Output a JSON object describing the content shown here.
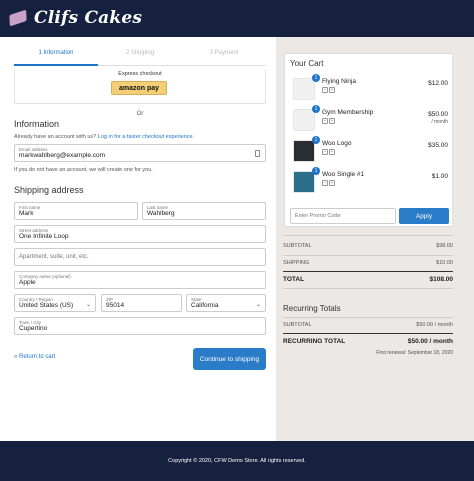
{
  "brand": {
    "name": "Clifs Cakes"
  },
  "steps": [
    "1 Information",
    "2 Shipping",
    "3 Payment"
  ],
  "express": {
    "label": "Express checkout",
    "amazon_label": "amazon pay"
  },
  "or_text": "Or",
  "information": {
    "heading": "Information",
    "login_prefix": "Already have an account with us?",
    "login_link": "Log in for a faster checkout experience.",
    "email_label": "Email address",
    "email_value": "markwahlberg@example.com",
    "note": "If you do not have an account, we will create one for you."
  },
  "shipping": {
    "heading": "Shipping address",
    "first_name_label": "First name",
    "first_name": "Mark",
    "last_name_label": "Last name",
    "last_name": "Wahlberg",
    "street_label": "Street address",
    "street": "One Infinite Loop",
    "apt_placeholder": "Apartment, suite, unit, etc.",
    "company_label": "Company name (optional)",
    "company": "Apple",
    "country_label": "Country / Region",
    "country": "United States (US)",
    "zip_label": "ZIP",
    "zip": "95014",
    "state_label": "State",
    "state": "California",
    "city_label": "Town / City",
    "city": "Cupertino"
  },
  "actions": {
    "return": "« Return to cart",
    "continue": "Continue to shipping"
  },
  "cart": {
    "title": "Your Cart",
    "items": [
      {
        "name": "Flying Ninja",
        "qty": "1",
        "price": "$12.00",
        "per": ""
      },
      {
        "name": "Gym Membership",
        "qty": "1",
        "price": "$50.00",
        "per": "/ month"
      },
      {
        "name": "Woo Logo",
        "qty": "1",
        "price": "$35.00",
        "per": ""
      },
      {
        "name": "Woo Single #1",
        "qty": "1",
        "price": "$1.00",
        "per": ""
      }
    ],
    "promo_placeholder": "Enter Promo Code",
    "apply": "Apply"
  },
  "totals": {
    "subtotal_label": "SUBTOTAL",
    "subtotal": "$98.00",
    "shipping_label": "SHIPPING",
    "shipping": "$10.00",
    "total_label": "TOTAL",
    "total": "$108.00"
  },
  "recurring": {
    "title": "Recurring Totals",
    "subtotal_label": "SUBTOTAL",
    "subtotal": "$50.00 / month",
    "total_label": "RECURRING TOTAL",
    "total": "$50.00 / month",
    "renewal": "First renewal: September 18, 2020"
  },
  "footer": {
    "text": "Copyright © 2020, CFW Demo Store. All rights reserved."
  },
  "colors": {
    "header": "#15213f",
    "accent": "#1e74c7"
  }
}
